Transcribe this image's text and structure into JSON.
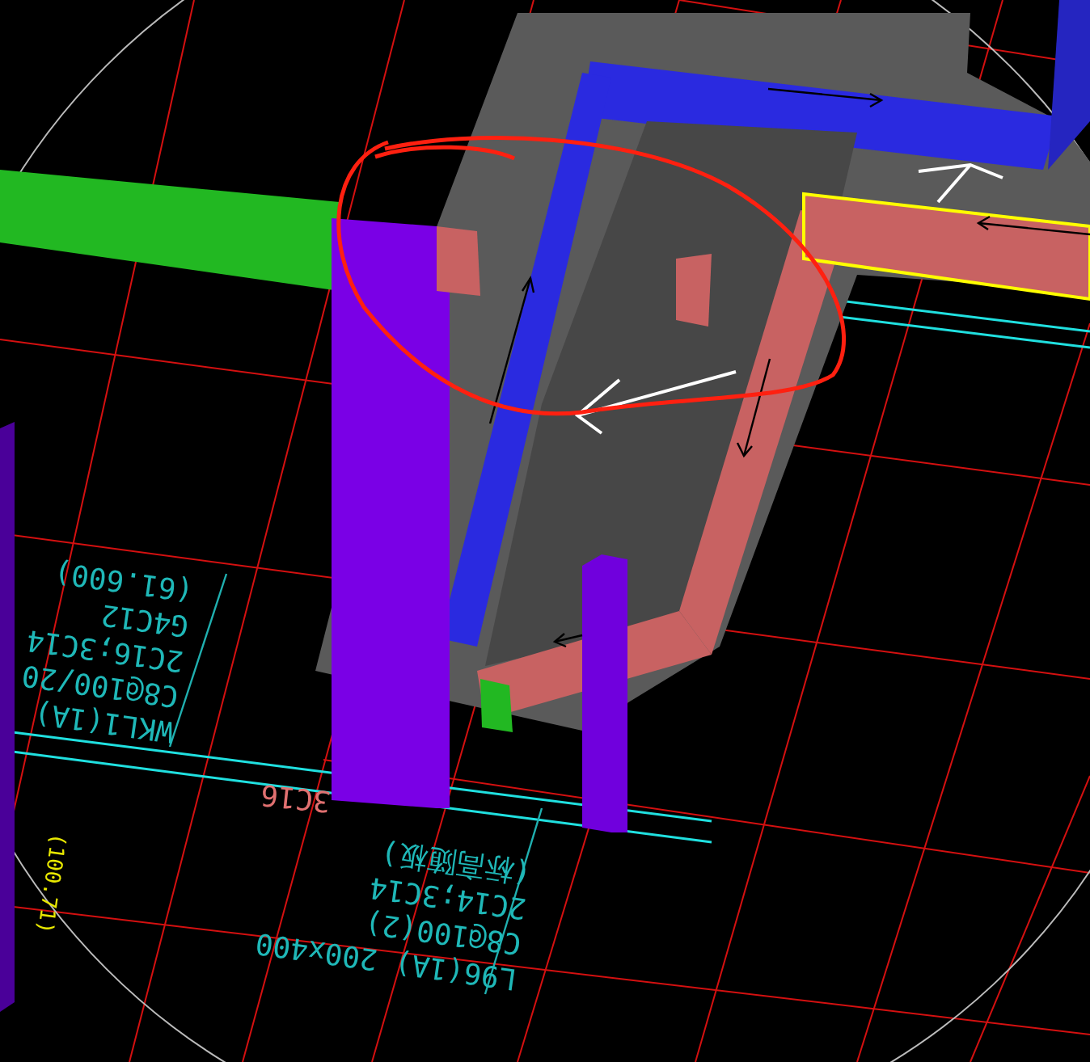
{
  "viewport": {
    "labels": [
      {
        "kind": "beam-annotation",
        "lines": [
          "WKL1(1A)",
          "C8@100/20",
          "2C16;3C14",
          "G4C12",
          "(61.600)"
        ]
      },
      {
        "kind": "beam-annotation",
        "lines": [
          "L96(1A) 200x400",
          "C8@100(2)",
          "2C14;3C14",
          "(标高随板)"
        ]
      },
      {
        "kind": "bar-count",
        "lines": [
          "3C16"
        ]
      },
      {
        "kind": "elevation",
        "lines": [
          "(100.71)"
        ]
      }
    ]
  }
}
